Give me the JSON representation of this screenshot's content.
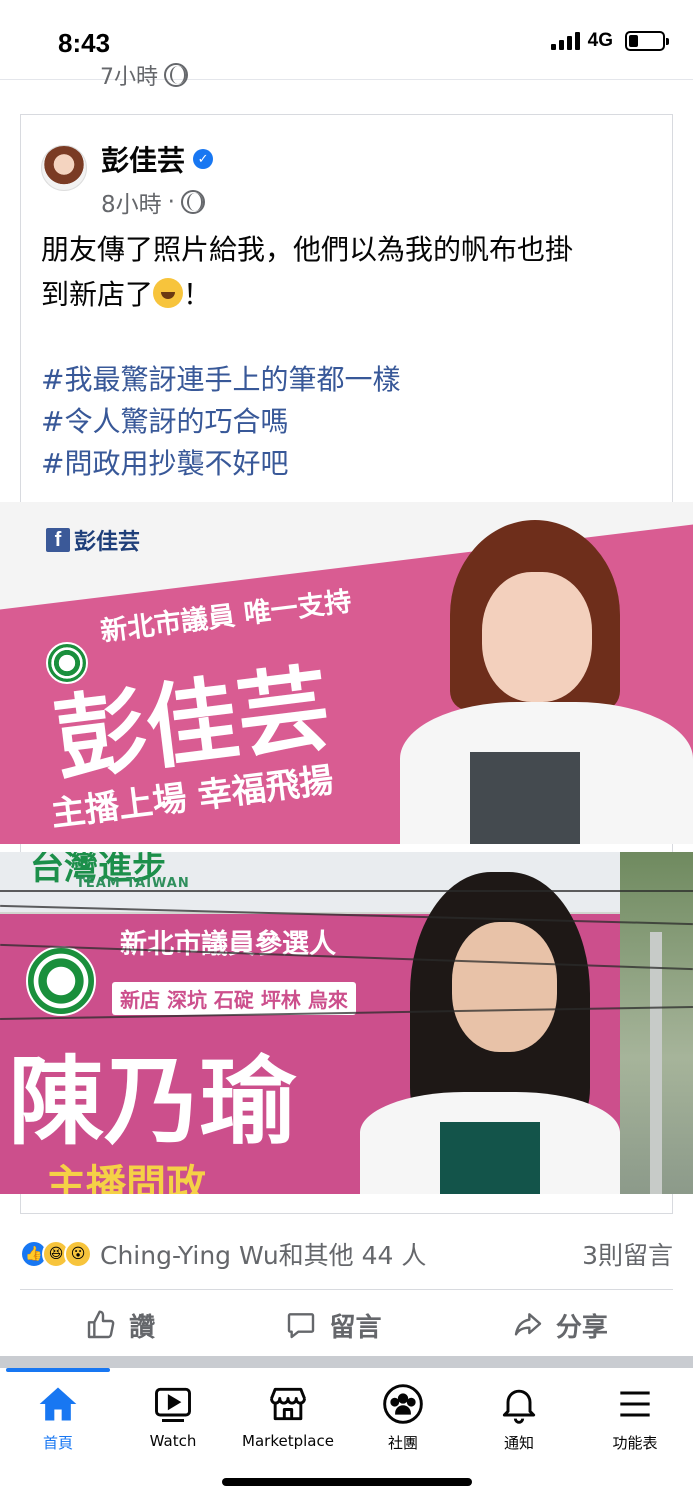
{
  "status": {
    "time": "8:43",
    "network": "4G"
  },
  "prev_post": {
    "time_fragment": "7小時"
  },
  "post": {
    "author": "彭佳芸",
    "time": "8小時",
    "separator": "·",
    "text_line1": "朋友傳了照片給我，他們以為我的帆布也掛",
    "text_line2a": "到新店了",
    "text_line2b": "！",
    "hashtags": [
      "#我最驚訝連手上的筆都一樣",
      "#令人驚訝的巧合嗎",
      "#問政用抄襲不好吧"
    ],
    "images": {
      "top": {
        "fb_logo": "f",
        "page_name": "彭佳芸",
        "subtitle": "新北市議員 唯一支持",
        "name": "彭佳芸",
        "slogan": "主播上場 幸福飛揚"
      },
      "bottom": {
        "header": "台灣進步",
        "header_en": "TEAM TAIWAN",
        "subtitle": "新北市議員參選人",
        "districts": "新店 深坑 石碇 坪林 烏來",
        "name": "陳乃瑜",
        "slogan": "主播問政"
      }
    },
    "reactions": {
      "names": "Ching-Ying Wu和其他 44 人",
      "comments": "3則留言"
    },
    "actions": {
      "like": "讚",
      "comment": "留言",
      "share": "分享"
    }
  },
  "tabbar": {
    "items": [
      {
        "label": "首頁",
        "icon": "home-icon"
      },
      {
        "label": "Watch",
        "icon": "watch-icon"
      },
      {
        "label": "Marketplace",
        "icon": "marketplace-icon"
      },
      {
        "label": "社團",
        "icon": "groups-icon"
      },
      {
        "label": "通知",
        "icon": "bell-icon"
      },
      {
        "label": "功能表",
        "icon": "menu-icon"
      }
    ],
    "active": "首頁"
  },
  "colors": {
    "accent": "#1877f2",
    "hashtag": "#385898",
    "banner_pink": "#d95c92"
  }
}
